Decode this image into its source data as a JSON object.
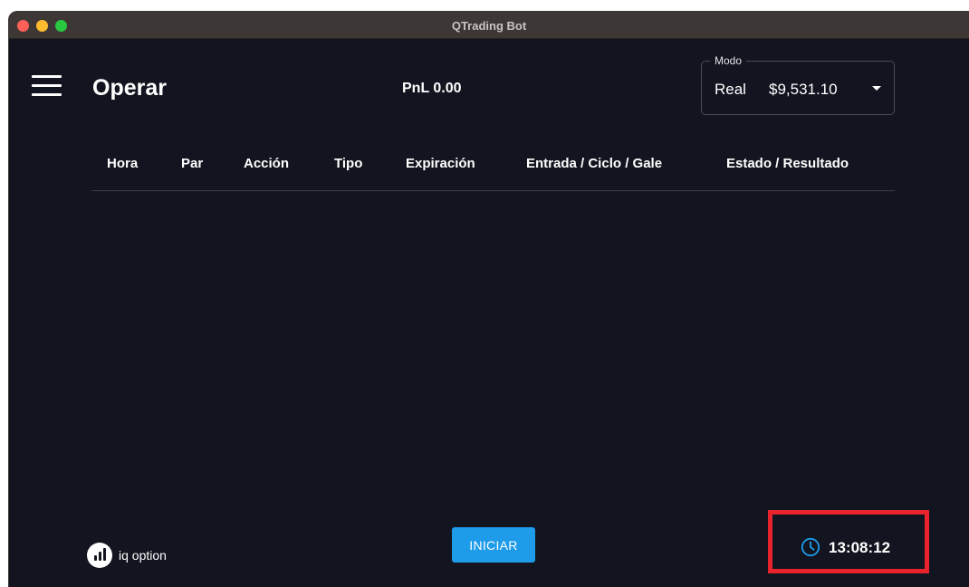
{
  "window": {
    "title": "QTrading Bot"
  },
  "header": {
    "page_title": "Operar",
    "pnl": "PnL 0.00",
    "mode": {
      "legend": "Modo",
      "value": "Real",
      "amount": "$9,531.10"
    }
  },
  "table": {
    "columns": [
      "Hora",
      "Par",
      "Acción",
      "Tipo",
      "Expiración",
      "Entrada / Ciclo / Gale",
      "Estado / Resultado"
    ],
    "rows": []
  },
  "footer": {
    "brand": "iq option",
    "start_label": "INICIAR",
    "time": "13:08:12"
  },
  "colors": {
    "background": "#12141f",
    "accent": "#1e9be9",
    "highlight_border": "#e8232c",
    "clock_icon": "#1e9be9"
  },
  "icons": {
    "menu": "hamburger-menu-icon",
    "dropdown": "caret-down-icon",
    "clock": "clock-icon",
    "brand": "iq-option-logo"
  }
}
